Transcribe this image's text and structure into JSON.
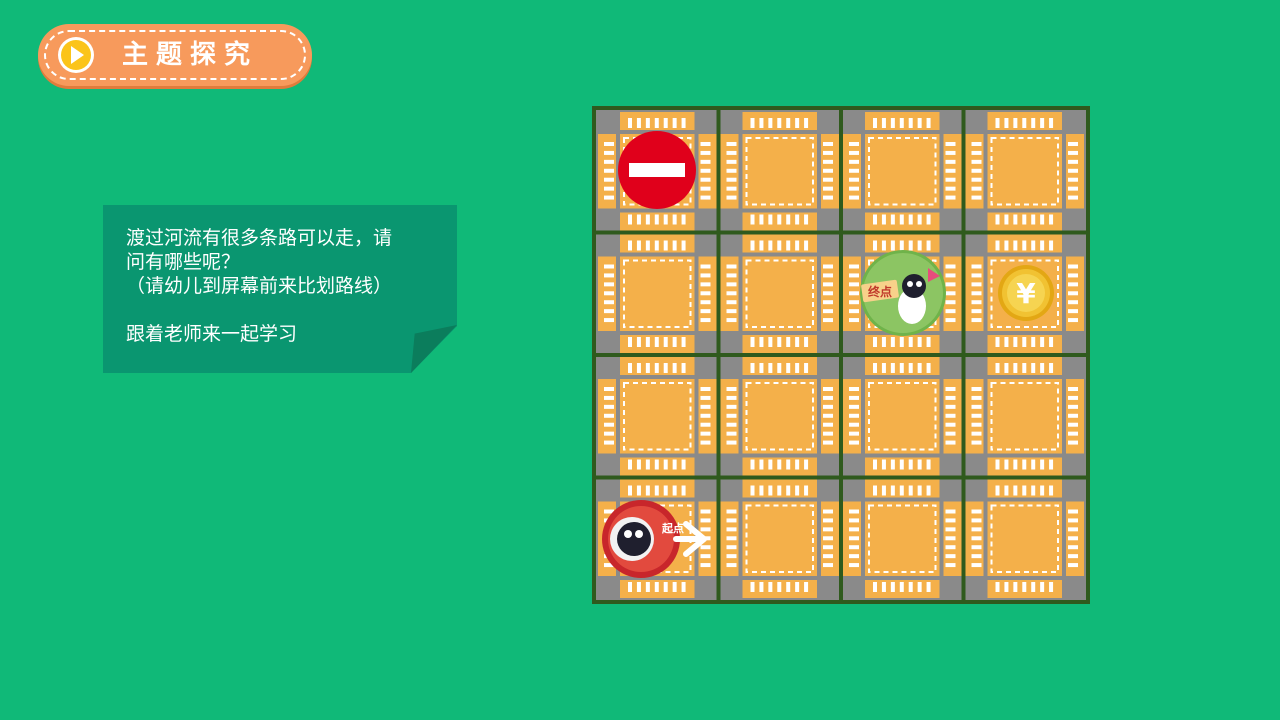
{
  "header": {
    "title": "主题探究",
    "play_icon": "play-icon"
  },
  "question_card": {
    "lines": [
      "渡过河流有很多条路可以走，请",
      "问有哪些呢？",
      "（请幼儿到屏幕前来比划路线）",
      "跟着老师来一起学习"
    ]
  },
  "maze": {
    "rows": 4,
    "cols": 4,
    "markers": {
      "start_label": "起点",
      "end_label": "终点",
      "coin_symbol": "¥",
      "no_entry_icon": "no-entry-icon",
      "arrow_icon": "right-arrow-icon"
    }
  },
  "colors": {
    "background": "#10b978",
    "badge": "#f79a5c",
    "road": "#8a8a8a",
    "block": "#f4b04a",
    "grid": "#2f5a1d",
    "no_entry": "#e0001b",
    "coin": "#f1c232"
  }
}
